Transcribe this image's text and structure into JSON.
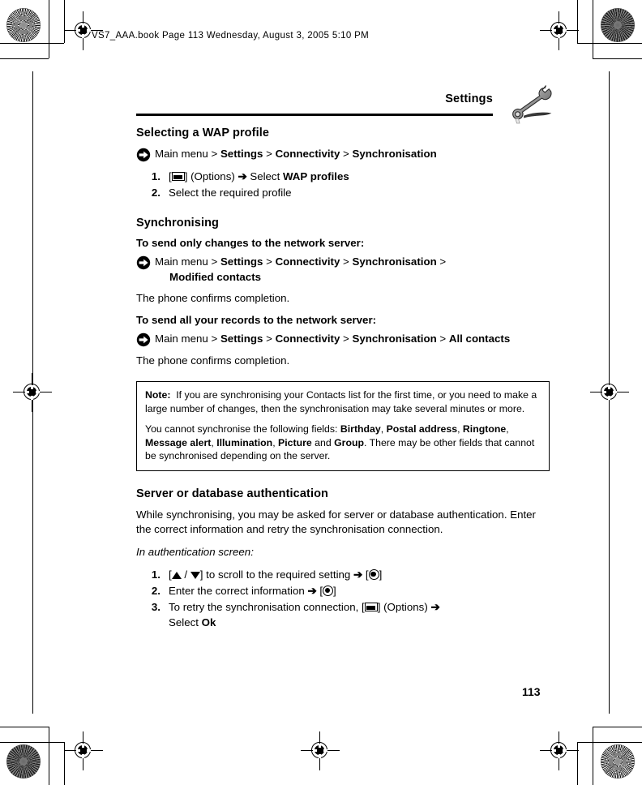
{
  "printer_stamp": "VS7_AAA.book  Page 113  Wednesday, August 3, 2005  5:10 PM",
  "running_head": {
    "title": "Settings",
    "icon": "wrench-icon"
  },
  "folio": "113",
  "sections": [
    {
      "id": "selecting-wap-profile",
      "heading": "Selecting a WAP profile",
      "path": {
        "bullet_icon": "arrow-in-circle-icon",
        "prefix": "Main menu > ",
        "crumbs": [
          "Settings",
          "Connectivity",
          "Synchronisation"
        ],
        "separator": " > "
      },
      "steps": [
        {
          "num": "1.",
          "pre": "[",
          "key_icon": "softkey-icon",
          "post": "] (Options) ",
          "arrow": "➔",
          "tail_plain": " Select ",
          "tail_bold": "WAP profiles"
        },
        {
          "num": "2.",
          "text": "Select the required profile"
        }
      ]
    },
    {
      "id": "synchronising",
      "heading": "Synchronising",
      "sub1_lead": "To send only changes to the network server:",
      "path1": {
        "bullet_icon": "arrow-in-circle-icon",
        "prefix": "Main menu > ",
        "crumbs": [
          "Settings",
          "Connectivity",
          "Synchronisation",
          "Modified contacts"
        ],
        "separator": " > ",
        "wrap_last": true
      },
      "confirm1": "The phone confirms completion.",
      "sub2_lead": "To send all your records to the network server:",
      "path2": {
        "bullet_icon": "arrow-in-circle-icon",
        "prefix": "Main menu > ",
        "crumbs": [
          "Settings",
          "Connectivity",
          "Synchronisation",
          "All contacts"
        ],
        "separator": " > ",
        "wrap_last": true
      },
      "confirm2": "The phone confirms completion."
    }
  ],
  "note_box": {
    "label": "Note:",
    "para1": "If you are synchronising your Contacts list for the first time, or you need to make a large number of changes, then the synchronisation may take several minutes or more.",
    "para2_a": "You cannot synchronise the following fields: ",
    "para2_fields": [
      "Birthday",
      "Postal address",
      "Ringtone",
      "Message alert",
      "Illumination",
      "Picture",
      "Group"
    ],
    "para2_b": ". There may be other fields that cannot be synchronised depending on the server."
  },
  "auth_section": {
    "heading": "Server or database authentication",
    "body": "While synchronising, you may be asked for server or database authentication. Enter the correct information and retry the synchronisation connection.",
    "italic_lead": "In authentication screen:",
    "steps": [
      {
        "num": "1.",
        "seg_a": "[",
        "icon_up": "triangle-up-icon",
        "slash": " / ",
        "icon_dn": "triangle-down-icon",
        "seg_b": "] to scroll to the required setting ",
        "arrow": "➔",
        "seg_c": " [",
        "icon_nav": "navigation-center-key-icon",
        "seg_d": "]"
      },
      {
        "num": "2.",
        "seg_a": "Enter the correct information ",
        "arrow": "➔",
        "seg_c": " [",
        "icon_nav": "navigation-center-key-icon",
        "seg_d": "]"
      },
      {
        "num": "3.",
        "seg_a": "To retry the synchronisation connection, [",
        "icon_soft": "softkey-icon",
        "seg_b": "] (Options) ",
        "arrow": "➔",
        "cont_plain": "Select ",
        "cont_bold": "Ok"
      }
    ]
  },
  "colors": {
    "ink": "#000000",
    "paper": "#ffffff"
  }
}
